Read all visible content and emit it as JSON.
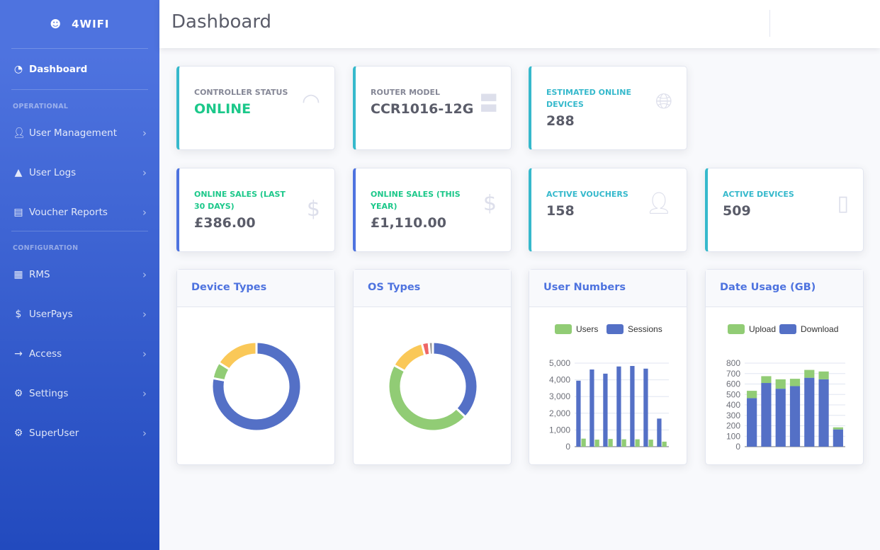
{
  "brand": "4WIFI",
  "sidebar": {
    "dashboard": "Dashboard",
    "heading_operational": "OPERATIONAL",
    "heading_configuration": "CONFIGURATION",
    "items": [
      {
        "label": "User Management"
      },
      {
        "label": "User Logs"
      },
      {
        "label": "Voucher Reports"
      },
      {
        "label": "RMS"
      },
      {
        "label": "UserPays"
      },
      {
        "label": "Access"
      },
      {
        "label": "Settings"
      },
      {
        "label": "SuperUser"
      }
    ]
  },
  "header": {
    "title": "Dashboard"
  },
  "stats": [
    {
      "label": "Controller Status",
      "value": "ONLINE"
    },
    {
      "label": "Router Model",
      "value": "CCR1016-12G"
    },
    {
      "label": "Estimated Online Devices",
      "value": "288"
    },
    {
      "label": "Online Sales (Last 30 Days)",
      "value": "£386.00"
    },
    {
      "label": "Online Sales (This Year)",
      "value": "£1,110.00"
    },
    {
      "label": "Active Vouchers",
      "value": "158"
    },
    {
      "label": "Active Devices",
      "value": "509"
    }
  ],
  "colors": {
    "primary": "#4e73df",
    "info": "#36b9cc",
    "success": "#1cc88a",
    "blue": "#5470c6",
    "green": "#91cc75",
    "yellow": "#fac858",
    "red": "#ee6666",
    "gray": "#9a9a9a"
  },
  "chart_data": [
    {
      "type": "pie",
      "title": "Device Types",
      "values": [
        78,
        6,
        16
      ],
      "colors": [
        "#5470c6",
        "#91cc75",
        "#fac858"
      ]
    },
    {
      "type": "pie",
      "title": "OS Types",
      "values": [
        37,
        46,
        13,
        2.5,
        1.5
      ],
      "colors": [
        "#5470c6",
        "#91cc75",
        "#fac858",
        "#ee6666",
        "#9a9a9a"
      ]
    },
    {
      "type": "bar",
      "title": "User Numbers",
      "legend": [
        "Users",
        "Sessions"
      ],
      "ylim": [
        0,
        5000
      ],
      "yticks": [
        "0",
        "1,000",
        "2,000",
        "3,000",
        "4,000",
        "5,000"
      ],
      "series": [
        {
          "name": "Users",
          "values": [
            480,
            420,
            460,
            440,
            440,
            420,
            300
          ]
        },
        {
          "name": "Sessions",
          "values": [
            3950,
            4620,
            4370,
            4800,
            4830,
            4670,
            1680
          ]
        }
      ]
    },
    {
      "type": "bar",
      "stacked": true,
      "title": "Date Usage (GB)",
      "legend": [
        "Upload",
        "Download"
      ],
      "ylim": [
        0,
        800
      ],
      "yticks": [
        "0",
        "100",
        "200",
        "300",
        "400",
        "500",
        "600",
        "700",
        "800"
      ],
      "series": [
        {
          "name": "Upload",
          "values": [
            70,
            65,
            90,
            70,
            75,
            75,
            20
          ]
        },
        {
          "name": "Download",
          "values": [
            465,
            610,
            555,
            580,
            660,
            645,
            165
          ]
        }
      ]
    }
  ]
}
